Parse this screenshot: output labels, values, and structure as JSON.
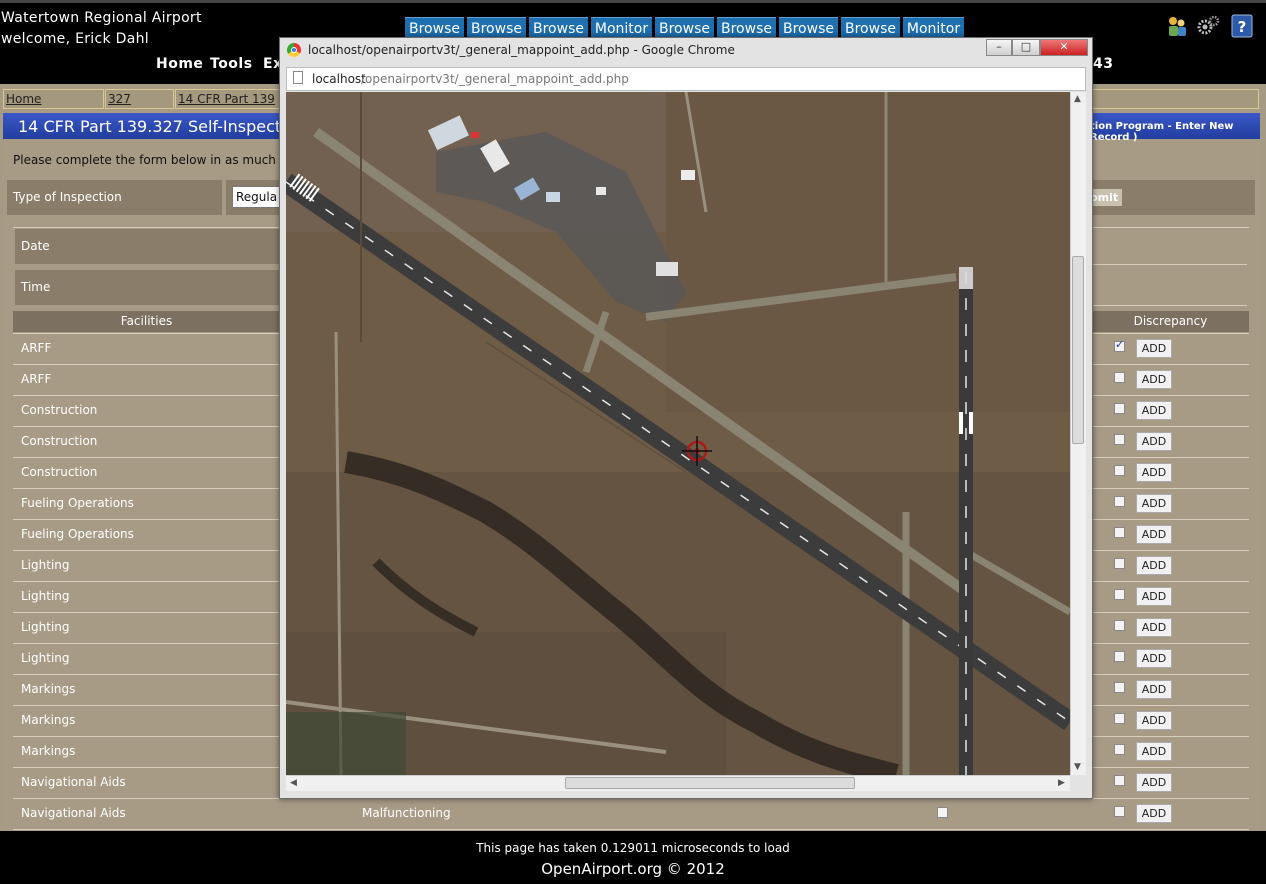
{
  "header": {
    "airport_name": "Watertown Regional Airport",
    "welcome": "welcome, Erick Dahl",
    "top_buttons": [
      "Browse",
      "Browse",
      "Browse",
      "Monitor",
      "Browse",
      "Browse",
      "Browse",
      "Browse",
      "Monitor"
    ],
    "nav": {
      "home": "Home",
      "tools": "Tools",
      "ex": "Ex",
      "right_fragment": "43"
    }
  },
  "breadcrumb": [
    "Home",
    "327",
    "14 CFR Part 139"
  ],
  "page": {
    "title": "14 CFR Part 139.327 Self-Inspectio",
    "title_right": "tion Program - Enter New Record )",
    "instructions": "Please complete the form below in as much deta",
    "type_label": "Type of Inspection",
    "type_value": "Regula",
    "submit_label": "bmit",
    "date_label": "Date",
    "time_label": "Time",
    "col_facilities": "Facilities",
    "col_discrepancy": "Discrepancy",
    "add_label": "ADD",
    "condition_last": "Malfunctioning"
  },
  "rows": [
    {
      "facility": "ARFF",
      "checked": true
    },
    {
      "facility": "ARFF",
      "checked": false
    },
    {
      "facility": "Construction",
      "checked": false
    },
    {
      "facility": "Construction",
      "checked": false
    },
    {
      "facility": "Construction",
      "checked": false
    },
    {
      "facility": "Fueling Operations",
      "checked": false
    },
    {
      "facility": "Fueling Operations",
      "checked": false
    },
    {
      "facility": "Lighting",
      "checked": false
    },
    {
      "facility": "Lighting",
      "checked": false
    },
    {
      "facility": "Lighting",
      "checked": false
    },
    {
      "facility": "Lighting",
      "checked": false
    },
    {
      "facility": "Markings",
      "checked": false
    },
    {
      "facility": "Markings",
      "checked": false
    },
    {
      "facility": "Markings",
      "checked": false
    },
    {
      "facility": "Navigational Aids",
      "checked": false
    },
    {
      "facility": "Navigational Aids",
      "checked": false
    }
  ],
  "popup": {
    "window_title": "localhost/openairportv3t/_general_mappoint_add.php - Google Chrome",
    "url_host": "localhost",
    "url_path": "/openairportv3t/_general_mappoint_add.php"
  },
  "footer": {
    "load_text": "This page has taken 0.129011 microseconds to load",
    "copyright": "OpenAirport.org © 2012"
  },
  "colors": {
    "title_bar": "#2a48b0",
    "top_button": "#1e6fb0",
    "page_bg": "#a79b86"
  }
}
